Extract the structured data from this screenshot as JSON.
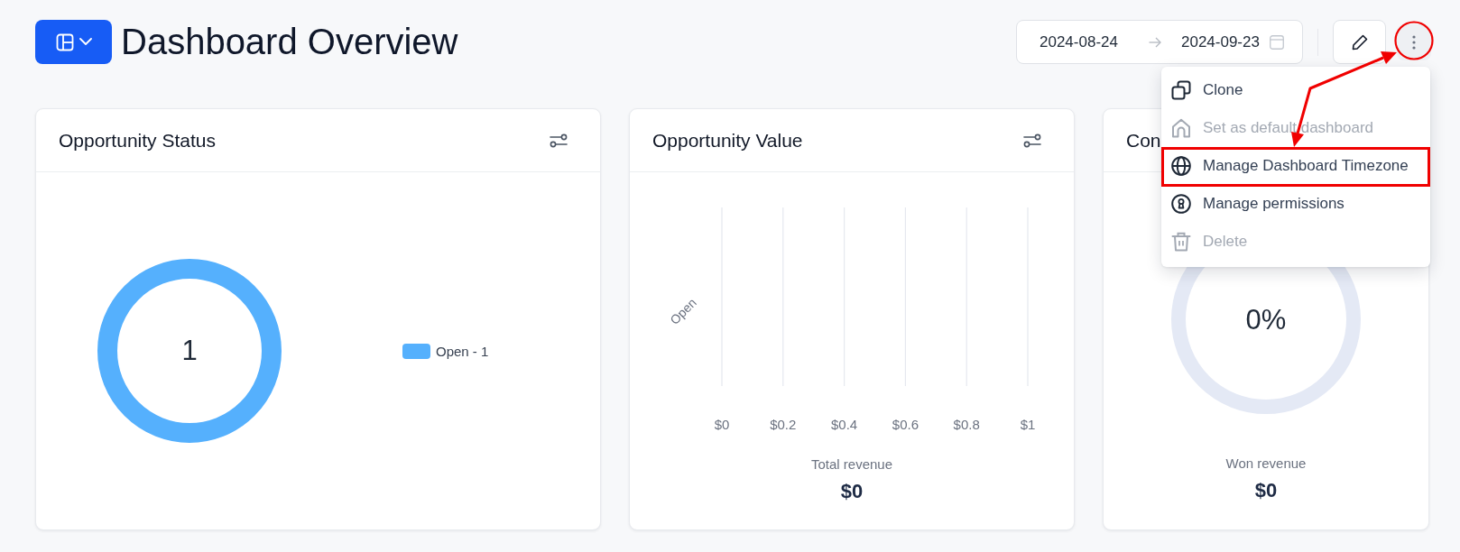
{
  "header": {
    "title": "Dashboard Overview"
  },
  "date_range": {
    "start": "2024-08-24",
    "end": "2024-09-23"
  },
  "more_button": {
    "circled": true
  },
  "more_menu": {
    "open": true,
    "items": [
      {
        "label": "Clone",
        "disabled": false,
        "highlighted": false
      },
      {
        "label": "Set as default dashboard",
        "disabled": true,
        "highlighted": false
      },
      {
        "label": "Manage Dashboard Timezone",
        "disabled": false,
        "highlighted": true
      },
      {
        "label": "Manage permissions",
        "disabled": false,
        "highlighted": false
      },
      {
        "label": "Delete",
        "disabled": true,
        "highlighted": false
      }
    ]
  },
  "cards": [
    {
      "kind": "donut",
      "title": "Opportunity Status",
      "settings_button": true,
      "center_text": "1",
      "legend": [
        {
          "label": "Open - 1",
          "color": "#55b0fd"
        }
      ]
    },
    {
      "kind": "bar",
      "title": "Opportunity Value",
      "settings_button": true,
      "chart_data": {
        "type": "bar",
        "orientation": "horizontal",
        "grid": true,
        "categories": [
          "Open"
        ],
        "values": [
          0
        ],
        "xlim": [
          0,
          1
        ],
        "xticks": [
          {
            "value": 0,
            "label": "$0"
          },
          {
            "value": 0.2,
            "label": "$0.2"
          },
          {
            "value": 0.4,
            "label": "$0.4"
          },
          {
            "value": 0.6,
            "label": "$0.6"
          },
          {
            "value": 0.8,
            "label": "$0.8"
          },
          {
            "value": 1,
            "label": "$1"
          }
        ]
      },
      "summary_label": "Total revenue",
      "summary_value": "$0"
    },
    {
      "kind": "gauge",
      "title": "Con",
      "gauge": {
        "text": "0%"
      },
      "summary_label": "Won revenue",
      "summary_value": "$0"
    }
  ],
  "annotations": [
    {
      "kind": "arrow"
    }
  ]
}
